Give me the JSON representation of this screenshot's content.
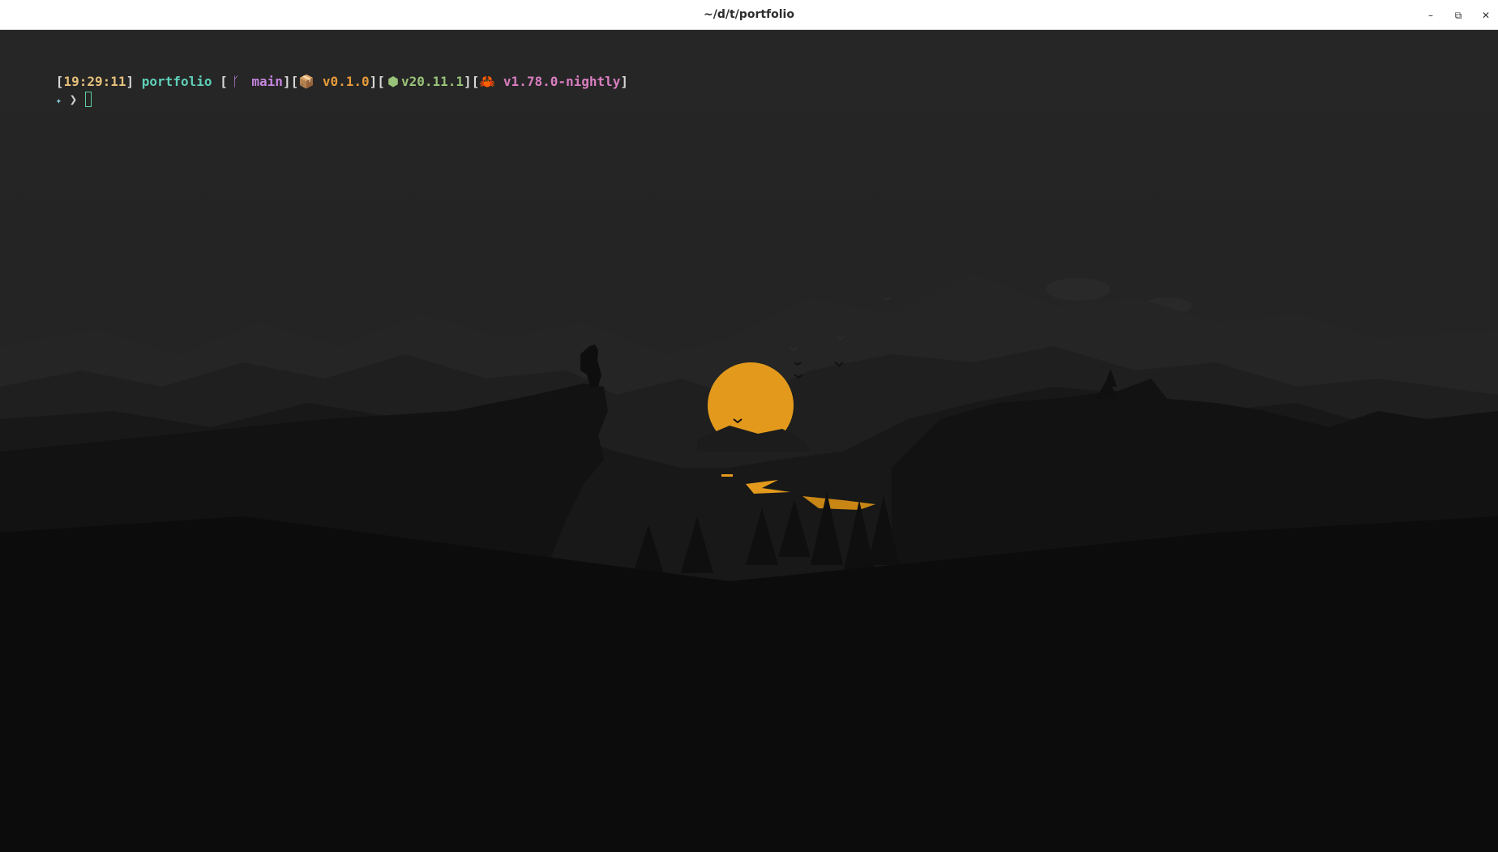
{
  "window": {
    "title": "~/d/t/portfolio",
    "controls": {
      "minimize": "–",
      "maximize": "⧉",
      "close": "✕"
    }
  },
  "prompt": {
    "open_bracket": "[",
    "time": "19:29:11",
    "close_bracket": "]",
    "directory": "portfolio",
    "git_open": "[",
    "git_icon": "",
    "git_branch": "main",
    "git_close": "]",
    "pkg_open": "[",
    "pkg_icon": "📦",
    "pkg_version": "v0.1.0",
    "pkg_close": "]",
    "node_open": "[",
    "node_icon": "⬢",
    "node_version": "v20.11.1",
    "node_close": "]",
    "rust_open": "[",
    "rust_icon": "🦀",
    "rust_version": "v1.78.0-nightly",
    "rust_close": "]",
    "symbol_star": "✦",
    "symbol_chevron": "❯"
  },
  "colors": {
    "time": "#e5c07b",
    "directory": "#5fcfb8",
    "branch": "#c586e0",
    "package": "#e59a3c",
    "node": "#98c379",
    "rust": "#d97ec0",
    "sun": "#e39a1c",
    "background": "#0b0b0b"
  }
}
